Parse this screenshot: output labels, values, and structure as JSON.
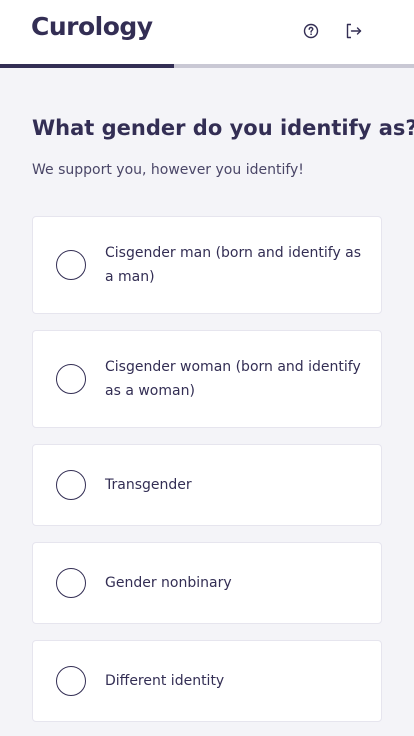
{
  "header": {
    "logo": "Curology",
    "help_icon": "help-circle-icon",
    "logout_icon": "logout-icon"
  },
  "progress": {
    "fraction": 0.42
  },
  "question": {
    "title": "What gender do you identify as?",
    "subtitle": "We support you, however you identify!"
  },
  "options": [
    {
      "label": "Cisgender man (born and identify as a man)"
    },
    {
      "label": "Cisgender woman (born and identify as a woman)"
    },
    {
      "label": "Transgender"
    },
    {
      "label": "Gender nonbinary"
    },
    {
      "label": "Different identity"
    }
  ],
  "colors": {
    "brand": "#332e54",
    "background": "#f4f4f8",
    "progress_track": "#c9c8d4"
  }
}
